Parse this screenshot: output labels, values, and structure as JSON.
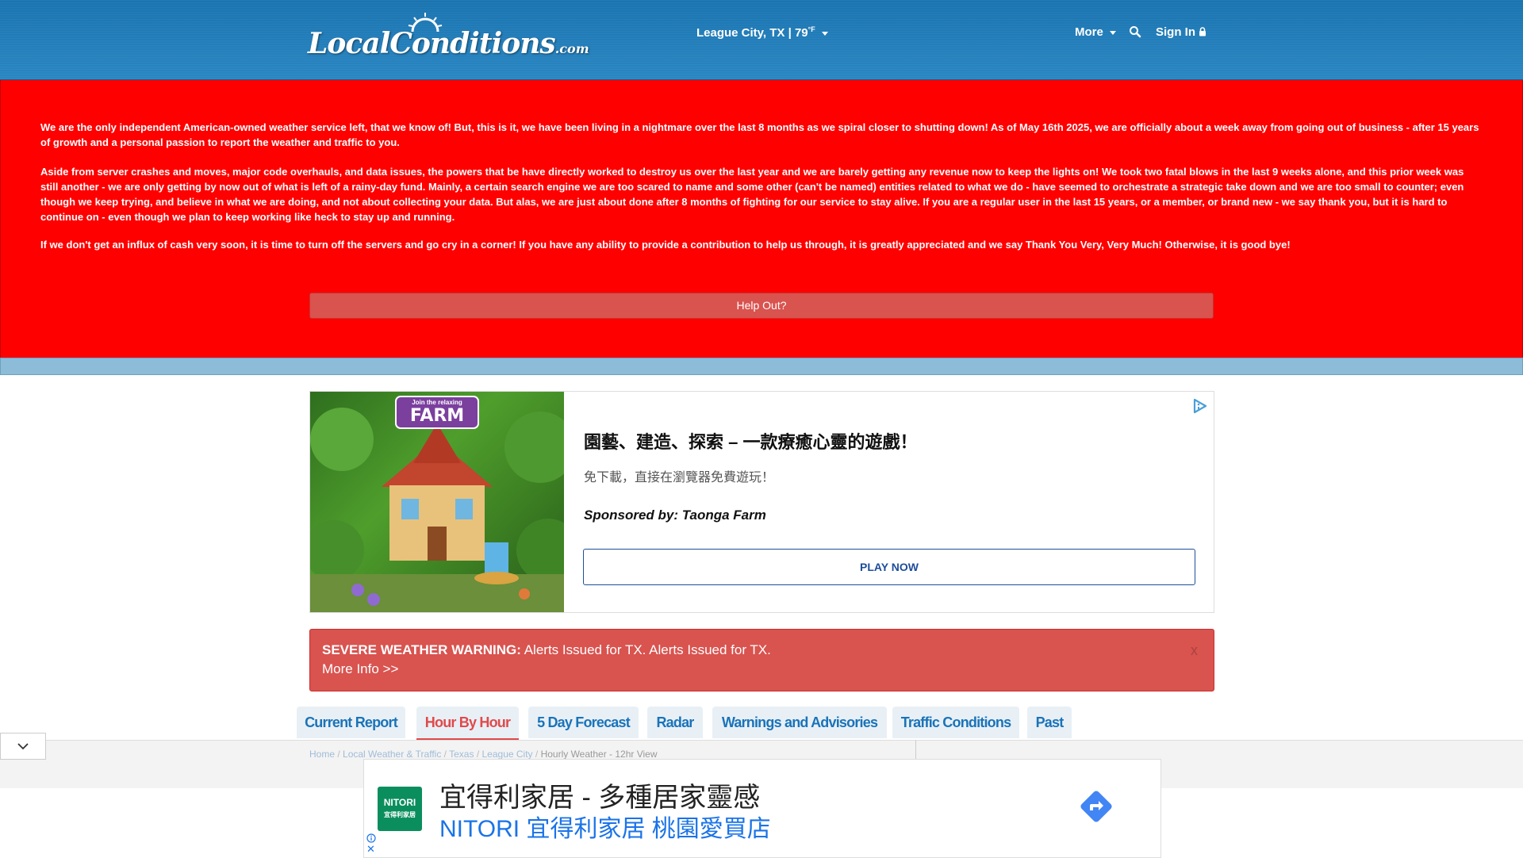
{
  "header": {
    "logo_main": "LocalConditions",
    "logo_suffix": ".com",
    "location_label": "League City, TX | 79",
    "temp_unit": "°F",
    "more_label": "More",
    "signin_label": "Sign In",
    "colors": {
      "bar": "#2a86c2",
      "text": "#ffffff"
    }
  },
  "notice": {
    "paragraph1": "We are the only independent American-owned weather service left, that we know of! But, this is it, we have been living in a nightmare over the last 8 months as we spiral closer to shutting down! As of May 16th 2025, we are officially about a week away from going out of business - after 15 years of growth and a personal passion to report the weather and traffic to you.",
    "paragraph2": "Aside from server crashes and moves, major code overhauls, and data issues, the powers that be have directly worked to destroy us over the last year and we are barely getting any revenue now to keep the lights on! We took two fatal blows in the last 9 weeks alone, and this prior week was still another - we are only getting by now out of what is left of a rainy-day fund. Mainly, a certain search engine we are too scared to name and some other (can't be named) entities related to what we do - have seemed to orchestrate a strategic take down and we are too small to counter; even though we keep trying, and believe in what we are doing, and not about collecting your data. But alas, we are just about done after 8 months of fighting for our service to stay alive. If you are a regular user in the last 15 years, or a member, or brand new - we say thank you, but it is hard to continue on - even though we plan to keep working like heck to stay up and running.",
    "paragraph3": "If we don't get an influx of cash very soon, it is time to turn off the servers and go cry in a corner! If you have any ability to provide a contribution to help us through, it is greatly appreciated and we say Thank You Very, Very Much! Otherwise, it is good bye!",
    "button_label": "Help Out?",
    "color": "#ff0000"
  },
  "ad": {
    "image_badge": "Join the relaxing",
    "image_title": "FARM",
    "title": "園藝、建造、探索 – 一款療癒心靈的遊戲！",
    "subtitle": "免下載，直接在瀏覽器免費遊玩！",
    "sponsor": "Sponsored by: Taonga Farm",
    "cta": "PLAY NOW"
  },
  "warning": {
    "label": "SEVERE WEATHER WARNING:",
    "text": " Alerts Issued for TX. Alerts Issued for TX.",
    "more": "More Info >>",
    "close": "x",
    "color": "#d9534f"
  },
  "tabs": [
    {
      "label": "Current Report",
      "active": false
    },
    {
      "label": "Hour By Hour",
      "active": true
    },
    {
      "label": "5 Day Forecast",
      "active": false
    },
    {
      "label": "Radar",
      "active": false
    },
    {
      "label": "Warnings and Advisories",
      "active": false
    },
    {
      "label": "Traffic Conditions",
      "active": false
    },
    {
      "label": "Past",
      "active": false
    }
  ],
  "breadcrumb": {
    "home": "Home",
    "sep": " / ",
    "local": "Local Weather & Traffic",
    "texas": "Texas",
    "city": "League City",
    "current": "Hourly Weather - 12hr View"
  },
  "bottom_ad": {
    "logo_top": "NITORI",
    "logo_bottom": "宜得利家居",
    "title": "宜得利家居 - 多種居家靈感",
    "subtitle": "NITORI 宜得利家居 桃園愛買店",
    "close": "✕"
  }
}
